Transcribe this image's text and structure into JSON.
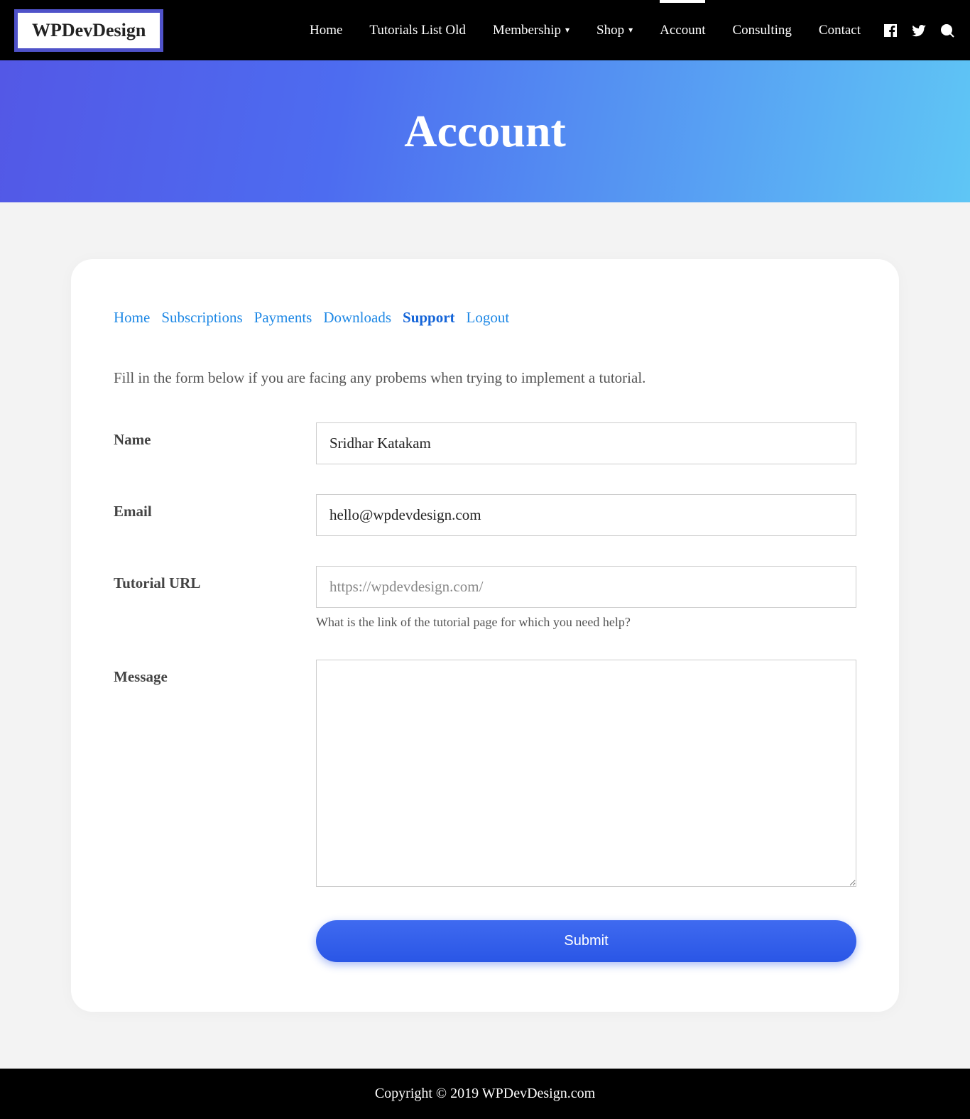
{
  "logo": "WPDevDesign",
  "nav": {
    "home": "Home",
    "tutorials": "Tutorials List Old",
    "membership": "Membership",
    "shop": "Shop",
    "account": "Account",
    "consulting": "Consulting",
    "contact": "Contact"
  },
  "hero": {
    "title": "Account"
  },
  "tabs": {
    "home": "Home",
    "subscriptions": "Subscriptions",
    "payments": "Payments",
    "downloads": "Downloads",
    "support": "Support",
    "logout": "Logout"
  },
  "intro": "Fill in the form below if you are facing any probems when trying to implement a tutorial.",
  "form": {
    "name_label": "Name",
    "name_value": "Sridhar Katakam",
    "email_label": "Email",
    "email_value": "hello@wpdevdesign.com",
    "url_label": "Tutorial URL",
    "url_placeholder": "https://wpdevdesign.com/",
    "url_value": "",
    "url_help": "What is the link of the tutorial page for which you need help?",
    "message_label": "Message",
    "message_value": "",
    "submit": "Submit"
  },
  "footer": "Copyright © 2019 WPDevDesign.com"
}
